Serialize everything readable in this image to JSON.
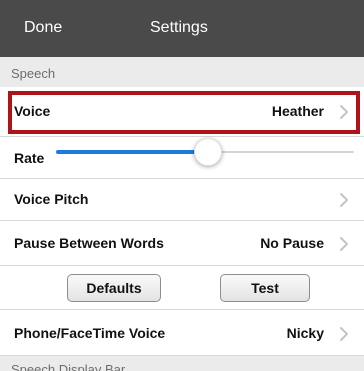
{
  "navbar": {
    "done_label": "Done",
    "title": "Settings"
  },
  "speech_section": {
    "header": "Speech"
  },
  "rows": {
    "voice": {
      "label": "Voice",
      "value": "Heather"
    },
    "rate": {
      "label": "Rate",
      "level_fraction": 0.51
    },
    "voice_pitch": {
      "label": "Voice Pitch"
    },
    "pause_between_words": {
      "label": "Pause Between Words",
      "value": "No Pause"
    },
    "phone_facetime_voice": {
      "label": "Phone/FaceTime Voice",
      "value": "Nicky"
    }
  },
  "buttons": {
    "defaults_label": "Defaults",
    "test_label": "Test"
  },
  "next_section": {
    "header": "Speech Display Bar"
  },
  "colors": {
    "navbar_bg": "#4a4a4a",
    "highlight_border": "#b0141b",
    "slider_fill": "#1f7ae0",
    "section_bg": "#ebebeb"
  },
  "icons": {
    "chevron": "chevron-right-icon"
  }
}
